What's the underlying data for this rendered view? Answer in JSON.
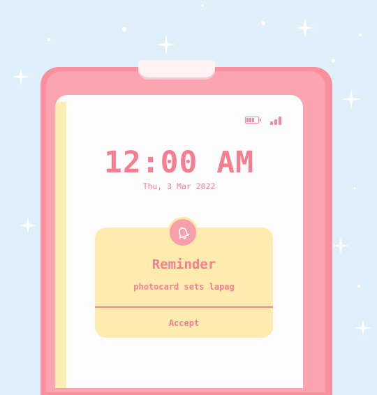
{
  "colors": {
    "background": "#dff0fb",
    "phone_frame": "#fca5b2",
    "accent_pink": "#f47f91",
    "card_yellow": "#fdebb0",
    "screen": "#fdfdfd"
  },
  "status_bar": {
    "battery_icon": "battery-icon",
    "signal_icon": "signal-icon"
  },
  "lock_screen": {
    "time": "12:00 AM",
    "date": "Thu, 3 Mar 2022"
  },
  "notification": {
    "icon": "bell-icon",
    "title": "Reminder",
    "message": "photocard sets lapag",
    "action_label": "Accept"
  }
}
